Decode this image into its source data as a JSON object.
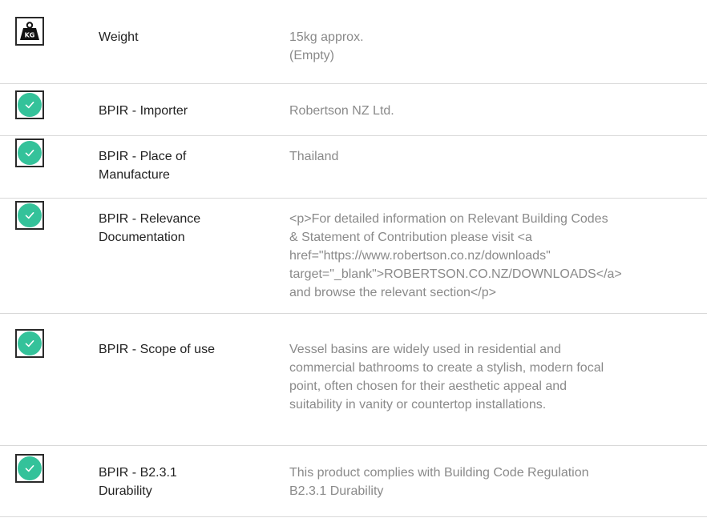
{
  "rows": [
    {
      "icon": "weight-kg-icon",
      "label_lines": [
        "Weight"
      ],
      "value_lines": [
        "15kg approx.",
        "(Empty)"
      ]
    },
    {
      "icon": "check-circle-icon",
      "label_lines": [
        "BPIR - Importer"
      ],
      "value_lines": [
        "Robertson NZ Ltd."
      ]
    },
    {
      "icon": "check-circle-icon",
      "label_lines": [
        "BPIR - Place of",
        "Manufacture"
      ],
      "value_lines": [
        "Thailand"
      ]
    },
    {
      "icon": "check-circle-icon",
      "label_lines": [
        "BPIR - Relevance",
        "Documentation"
      ],
      "value_lines": [
        "<p>For detailed information on Relevant Building Codes",
        "& Statement of Contribution please visit <a",
        "href=\"https://www.robertson.co.nz/downloads\"",
        "target=\"_blank\">ROBERTSON.CO.NZ/DOWNLOADS</a>",
        "and browse the relevant section</p>"
      ]
    },
    {
      "icon": "check-circle-icon",
      "label_lines": [
        "BPIR - Scope of use"
      ],
      "value_lines": [
        "Vessel basins are widely used in residential and",
        "commercial bathrooms to create a stylish, modern focal",
        "point, often chosen for their aesthetic appeal and",
        "suitability in vanity or countertop installations."
      ]
    },
    {
      "icon": "check-circle-icon",
      "label_lines": [
        "BPIR - B2.3.1",
        "Durability"
      ],
      "value_lines": [
        "This product complies with Building Code Regulation",
        "B2.3.1 Durability"
      ]
    }
  ],
  "colors": {
    "check_green": "#34c29a",
    "label_text": "#222222",
    "value_text": "#8a8a8a",
    "divider": "#d9d9d9"
  }
}
